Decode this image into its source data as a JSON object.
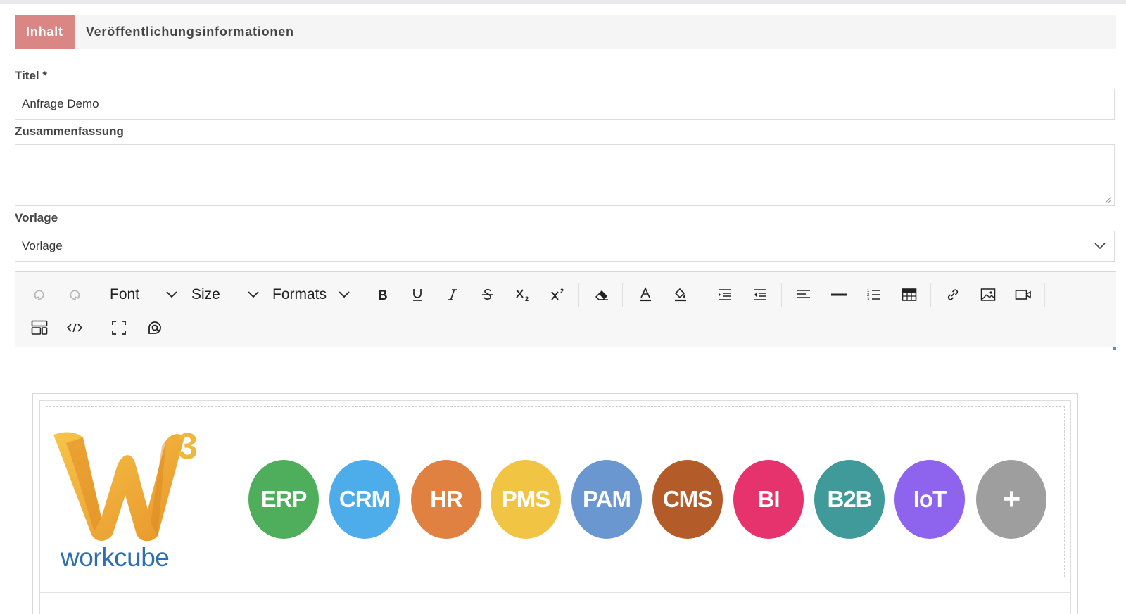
{
  "tabs": [
    {
      "label": "Inhalt",
      "active": true
    },
    {
      "label": "Veröffentlichungsinformationen",
      "active": false
    }
  ],
  "form": {
    "title_label": "Titel *",
    "title_value": "Anfrage Demo",
    "summary_label": "Zusammenfassung",
    "summary_value": "",
    "template_label": "Vorlage",
    "template_value": "Vorlage"
  },
  "toolbar": {
    "font_label": "Font",
    "size_label": "Size",
    "formats_label": "Formats",
    "icons": [
      "undo-icon",
      "redo-icon",
      "bold-icon",
      "underline-icon",
      "italic-icon",
      "strikethrough-icon",
      "subscript-icon",
      "superscript-icon",
      "eraser-icon",
      "font-color-icon",
      "highlight-icon",
      "indent-icon",
      "outdent-icon",
      "align-left-icon",
      "horizontal-rule-icon",
      "numbered-list-icon",
      "table-icon",
      "link-icon",
      "image-icon",
      "video-icon",
      "layout-icon",
      "code-icon",
      "fullscreen-icon",
      "mention-icon"
    ]
  },
  "content": {
    "logo_text": "workcube",
    "logo_mark": "W",
    "logo_sup": "3",
    "modules": [
      {
        "label": "ERP",
        "color": "#4fae5b"
      },
      {
        "label": "CRM",
        "color": "#4dacea"
      },
      {
        "label": "HR",
        "color": "#e08142"
      },
      {
        "label": "PMS",
        "color": "#f2c443"
      },
      {
        "label": "PAM",
        "color": "#6b97d0"
      },
      {
        "label": "CMS",
        "color": "#b35c2a"
      },
      {
        "label": "BI",
        "color": "#e6336d"
      },
      {
        "label": "B2B",
        "color": "#409a9a"
      },
      {
        "label": "IoT",
        "color": "#8e64ee"
      },
      {
        "label": "+",
        "color": "#9e9e9e"
      }
    ]
  },
  "colors": {
    "active_tab": "#d98685",
    "accent_scroll": "#4a90e2"
  }
}
